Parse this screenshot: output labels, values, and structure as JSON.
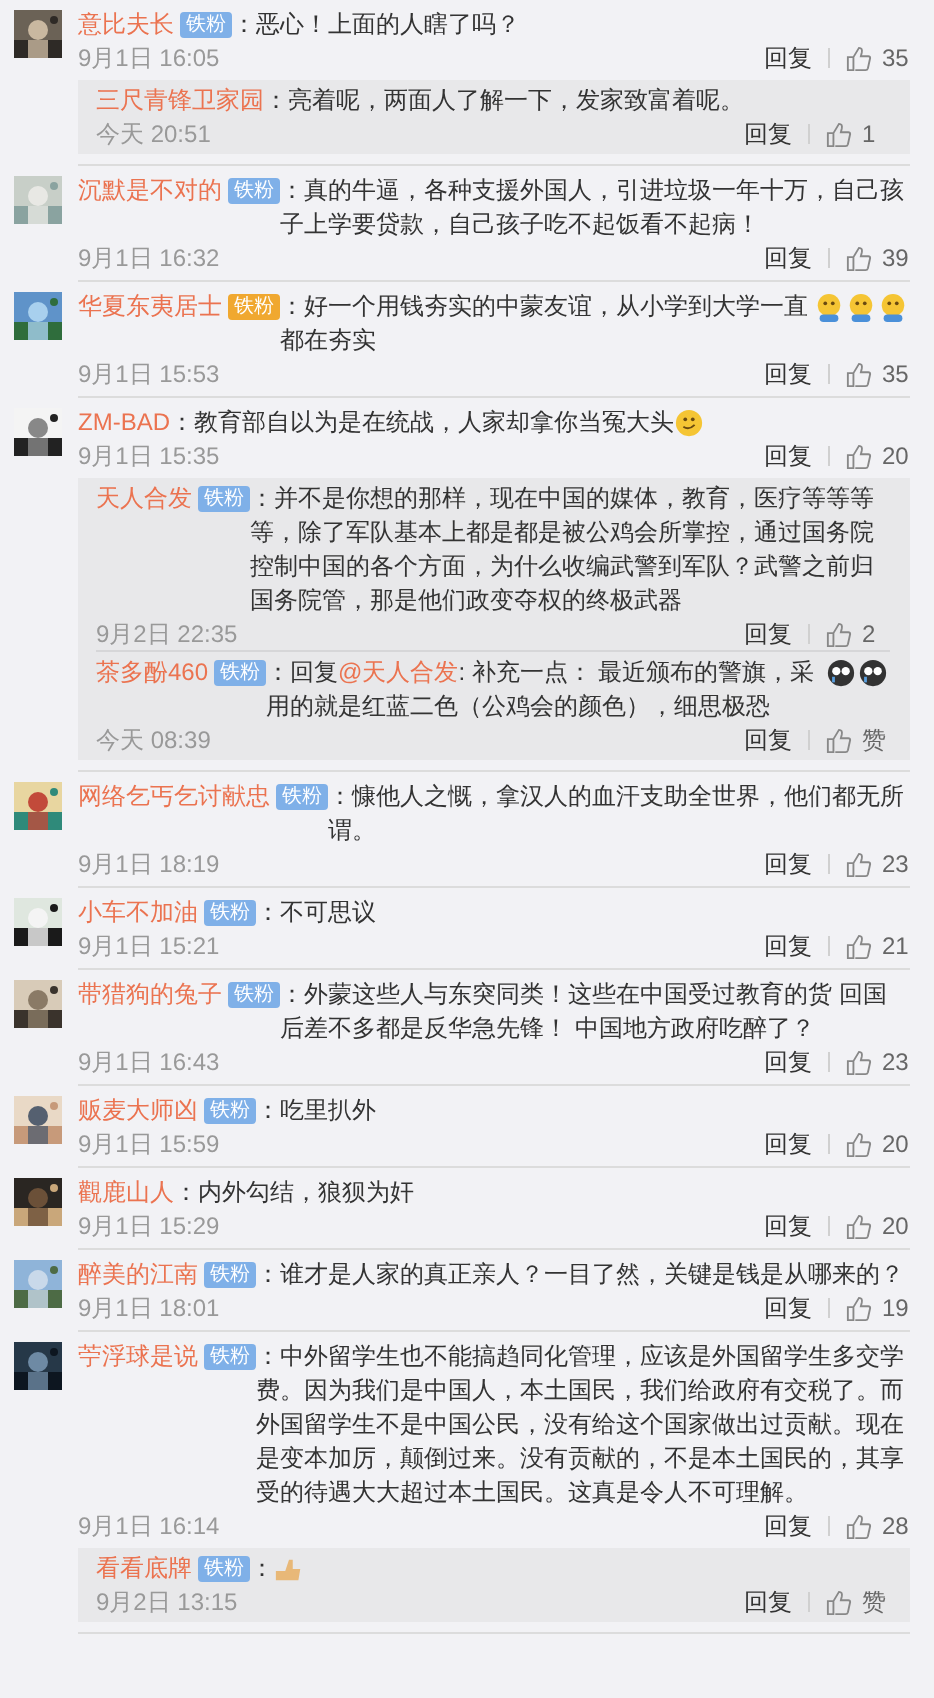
{
  "comments": [
    {
      "name": "意比夫长",
      "badge": {
        "label": "铁粉",
        "kind": "blue"
      },
      "text": "：恶心！上面的人瞎了吗？",
      "time": "9月1日 16:05",
      "reply_label": "回复",
      "likes": "35",
      "replies": [
        {
          "name": "三尺青锋卫家园",
          "text": "：亮着呢，两面人了解一下，发家致富着呢。",
          "time": "今天 20:51",
          "reply_label": "回复",
          "likes": "1"
        }
      ]
    },
    {
      "name": "沉默是不对的",
      "badge": {
        "label": "铁粉",
        "kind": "blue"
      },
      "text": "：真的牛逼，各种支援外国人，引进垃圾一年十万，自己孩子上学要贷款，自己孩子吃不起饭看不起病！",
      "time": "9月1日 16:32",
      "reply_label": "回复",
      "likes": "39"
    },
    {
      "name": "华夏东夷居士",
      "badge": {
        "label": "铁粉",
        "kind": "gold"
      },
      "text": "：好一个用钱夯实的中蒙友谊，从小学到大学一直都在夯实",
      "emojis": [
        {
          "kind": "grin"
        },
        {
          "kind": "grin"
        },
        {
          "kind": "grin"
        }
      ],
      "time": "9月1日 15:53",
      "reply_label": "回复",
      "likes": "35"
    },
    {
      "name": "ZM-BAD",
      "text": "：教育部自以为是在统战，人家却拿你当冤大头",
      "emojis": [
        {
          "kind": "smirk"
        }
      ],
      "time": "9月1日 15:35",
      "reply_label": "回复",
      "likes": "20",
      "replies": [
        {
          "name": "天人合发",
          "badge": {
            "label": "铁粉",
            "kind": "blue"
          },
          "text": "：并不是你想的那样，现在中国的媒体，教育，医疗等等等等，除了军队基本上都是都是被公鸡会所掌控，通过国务院控制中国的各个方面，为什么收编武警到军队？武警之前归国务院管，那是他们政变夺权的终极武器",
          "time": "9月2日 22:35",
          "reply_label": "回复",
          "likes": "2"
        },
        {
          "name": "茶多酚460",
          "badge": {
            "label": "铁粉",
            "kind": "blue"
          },
          "prefix": "：回复",
          "mention": "@天人合发",
          "text": ": 补充一点： 最近颁布的警旗，采用的就是红蓝二色（公鸡会的颜色），细思极恐",
          "emojis": [
            {
              "kind": "cry"
            },
            {
              "kind": "cry"
            }
          ],
          "time": "今天 08:39",
          "reply_label": "回复",
          "likes": "赞"
        }
      ]
    },
    {
      "name": "网络乞丐乞讨献忠",
      "badge": {
        "label": "铁粉",
        "kind": "blue"
      },
      "text": "：慷他人之慨，拿汉人的血汗支助全世界，他们都无所谓。",
      "time": "9月1日 18:19",
      "reply_label": "回复",
      "likes": "23"
    },
    {
      "name": "小车不加油",
      "badge": {
        "label": "铁粉",
        "kind": "blue"
      },
      "text": "：不可思议",
      "time": "9月1日 15:21",
      "reply_label": "回复",
      "likes": "21"
    },
    {
      "name": "带猎狗的兔子",
      "badge": {
        "label": "铁粉",
        "kind": "blue"
      },
      "text": "：外蒙这些人与东突同类！这些在中国受过教育的货  回国后差不多都是反华急先锋！ 中国地方政府吃醉了？",
      "time": "9月1日 16:43",
      "reply_label": "回复",
      "likes": "23"
    },
    {
      "name": "贩麦大师凶",
      "badge": {
        "label": "铁粉",
        "kind": "blue"
      },
      "text": "：吃里扒外",
      "time": "9月1日 15:59",
      "reply_label": "回复",
      "likes": "20"
    },
    {
      "name": "觀鹿山人",
      "text": "：内外勾结，狼狈为奸",
      "time": "9月1日 15:29",
      "reply_label": "回复",
      "likes": "20"
    },
    {
      "name": "醉美的江南",
      "badge": {
        "label": "铁粉",
        "kind": "blue"
      },
      "text": "：谁才是人家的真正亲人？一目了然，关键是钱是从哪来的？",
      "time": "9月1日 18:01",
      "reply_label": "回复",
      "likes": "19"
    },
    {
      "name": "苧浮球是说",
      "badge": {
        "label": "铁粉",
        "kind": "blue"
      },
      "text": "：中外留学生也不能搞趋同化管理，应该是外国留学生多交学费。因为我们是中国人，本土国民，我们给政府有交税了。而外国留学生不是中国公民，没有给这个国家做出过贡献。现在是变本加厉，颠倒过来。没有贡献的，不是本土国民的，其享受的待遇大大超过本土国民。这真是令人不可理解。",
      "time": "9月1日 16:14",
      "reply_label": "回复",
      "likes": "28",
      "replies": [
        {
          "name": "看看底牌",
          "badge": {
            "label": "铁粉",
            "kind": "blue"
          },
          "text": "：",
          "emojis": [
            {
              "kind": "thumbs"
            }
          ],
          "time": "9月2日 13:15",
          "reply_label": "回复",
          "likes": "赞"
        }
      ]
    }
  ]
}
